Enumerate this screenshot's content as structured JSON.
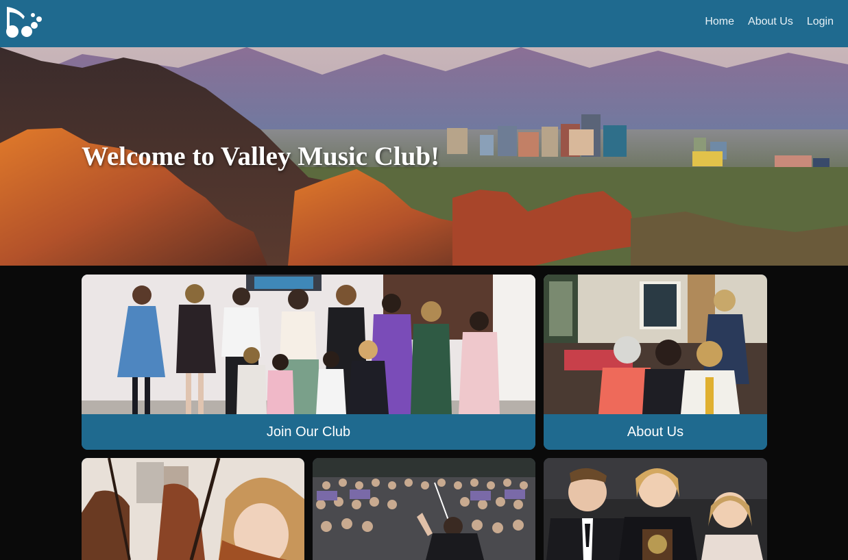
{
  "header": {
    "logo_icon": "music-notes-logo-icon",
    "nav": [
      {
        "label": "Home"
      },
      {
        "label": "About Us"
      },
      {
        "label": "Login"
      }
    ]
  },
  "hero": {
    "title": "Welcome to Valley Music Club!",
    "image": "mountain-city-skyline-photo"
  },
  "cards": {
    "join": {
      "label": "Join Our Club",
      "image": "children-group-photo"
    },
    "about": {
      "label": "About Us",
      "image": "women-members-photo"
    },
    "bottom": [
      {
        "image": "violin-student-photo"
      },
      {
        "image": "choir-conductor-photo"
      },
      {
        "image": "award-winners-photo"
      }
    ]
  },
  "colors": {
    "brand": "#1f6a8f",
    "page_background": "#0a0a0a",
    "text_light": "#ffffff"
  }
}
